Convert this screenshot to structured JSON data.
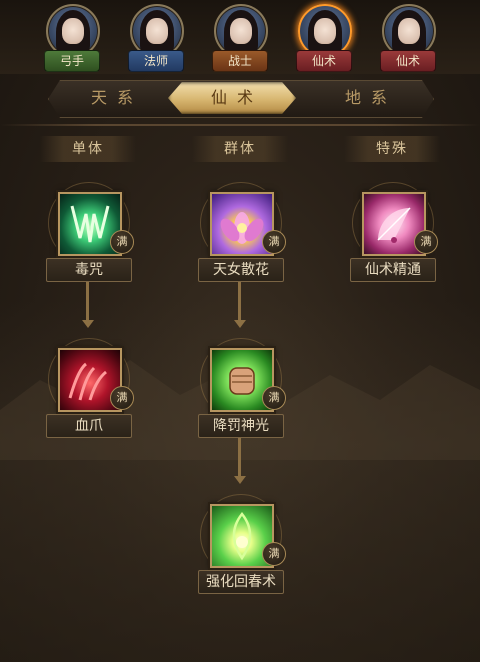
{
  "portraits": [
    {
      "name": "弓手",
      "color": "#4e7a3a",
      "active": false
    },
    {
      "name": "法师",
      "color": "#3a5a8a",
      "active": false
    },
    {
      "name": "战士",
      "color": "#9a5a2a",
      "active": false
    },
    {
      "name": "仙术",
      "color": "#9a3a3a",
      "active": true
    },
    {
      "name": "仙术",
      "color": "#9a3a3a",
      "active": false
    }
  ],
  "tabs": {
    "items": [
      "天系",
      "仙术",
      "地系"
    ],
    "active": "仙术"
  },
  "columns": [
    "单体",
    "群体",
    "特殊"
  ],
  "skills": {
    "duzhou": {
      "label": "毒咒",
      "badge": "满",
      "icon": "poison-fang-icon"
    },
    "tiannusanhua": {
      "label": "天女散花",
      "badge": "满",
      "icon": "lotus-icon"
    },
    "xianshujingtong": {
      "label": "仙术精通",
      "badge": "满",
      "icon": "fan-icon"
    },
    "xuezhua": {
      "label": "血爪",
      "badge": "满",
      "icon": "blood-claw-icon"
    },
    "jiangfashenguang": {
      "label": "降罚神光",
      "badge": "满",
      "icon": "fist-icon"
    },
    "qianghuahuichunshu": {
      "label": "强化回春术",
      "badge": "满",
      "icon": "spring-leaf-icon"
    }
  }
}
